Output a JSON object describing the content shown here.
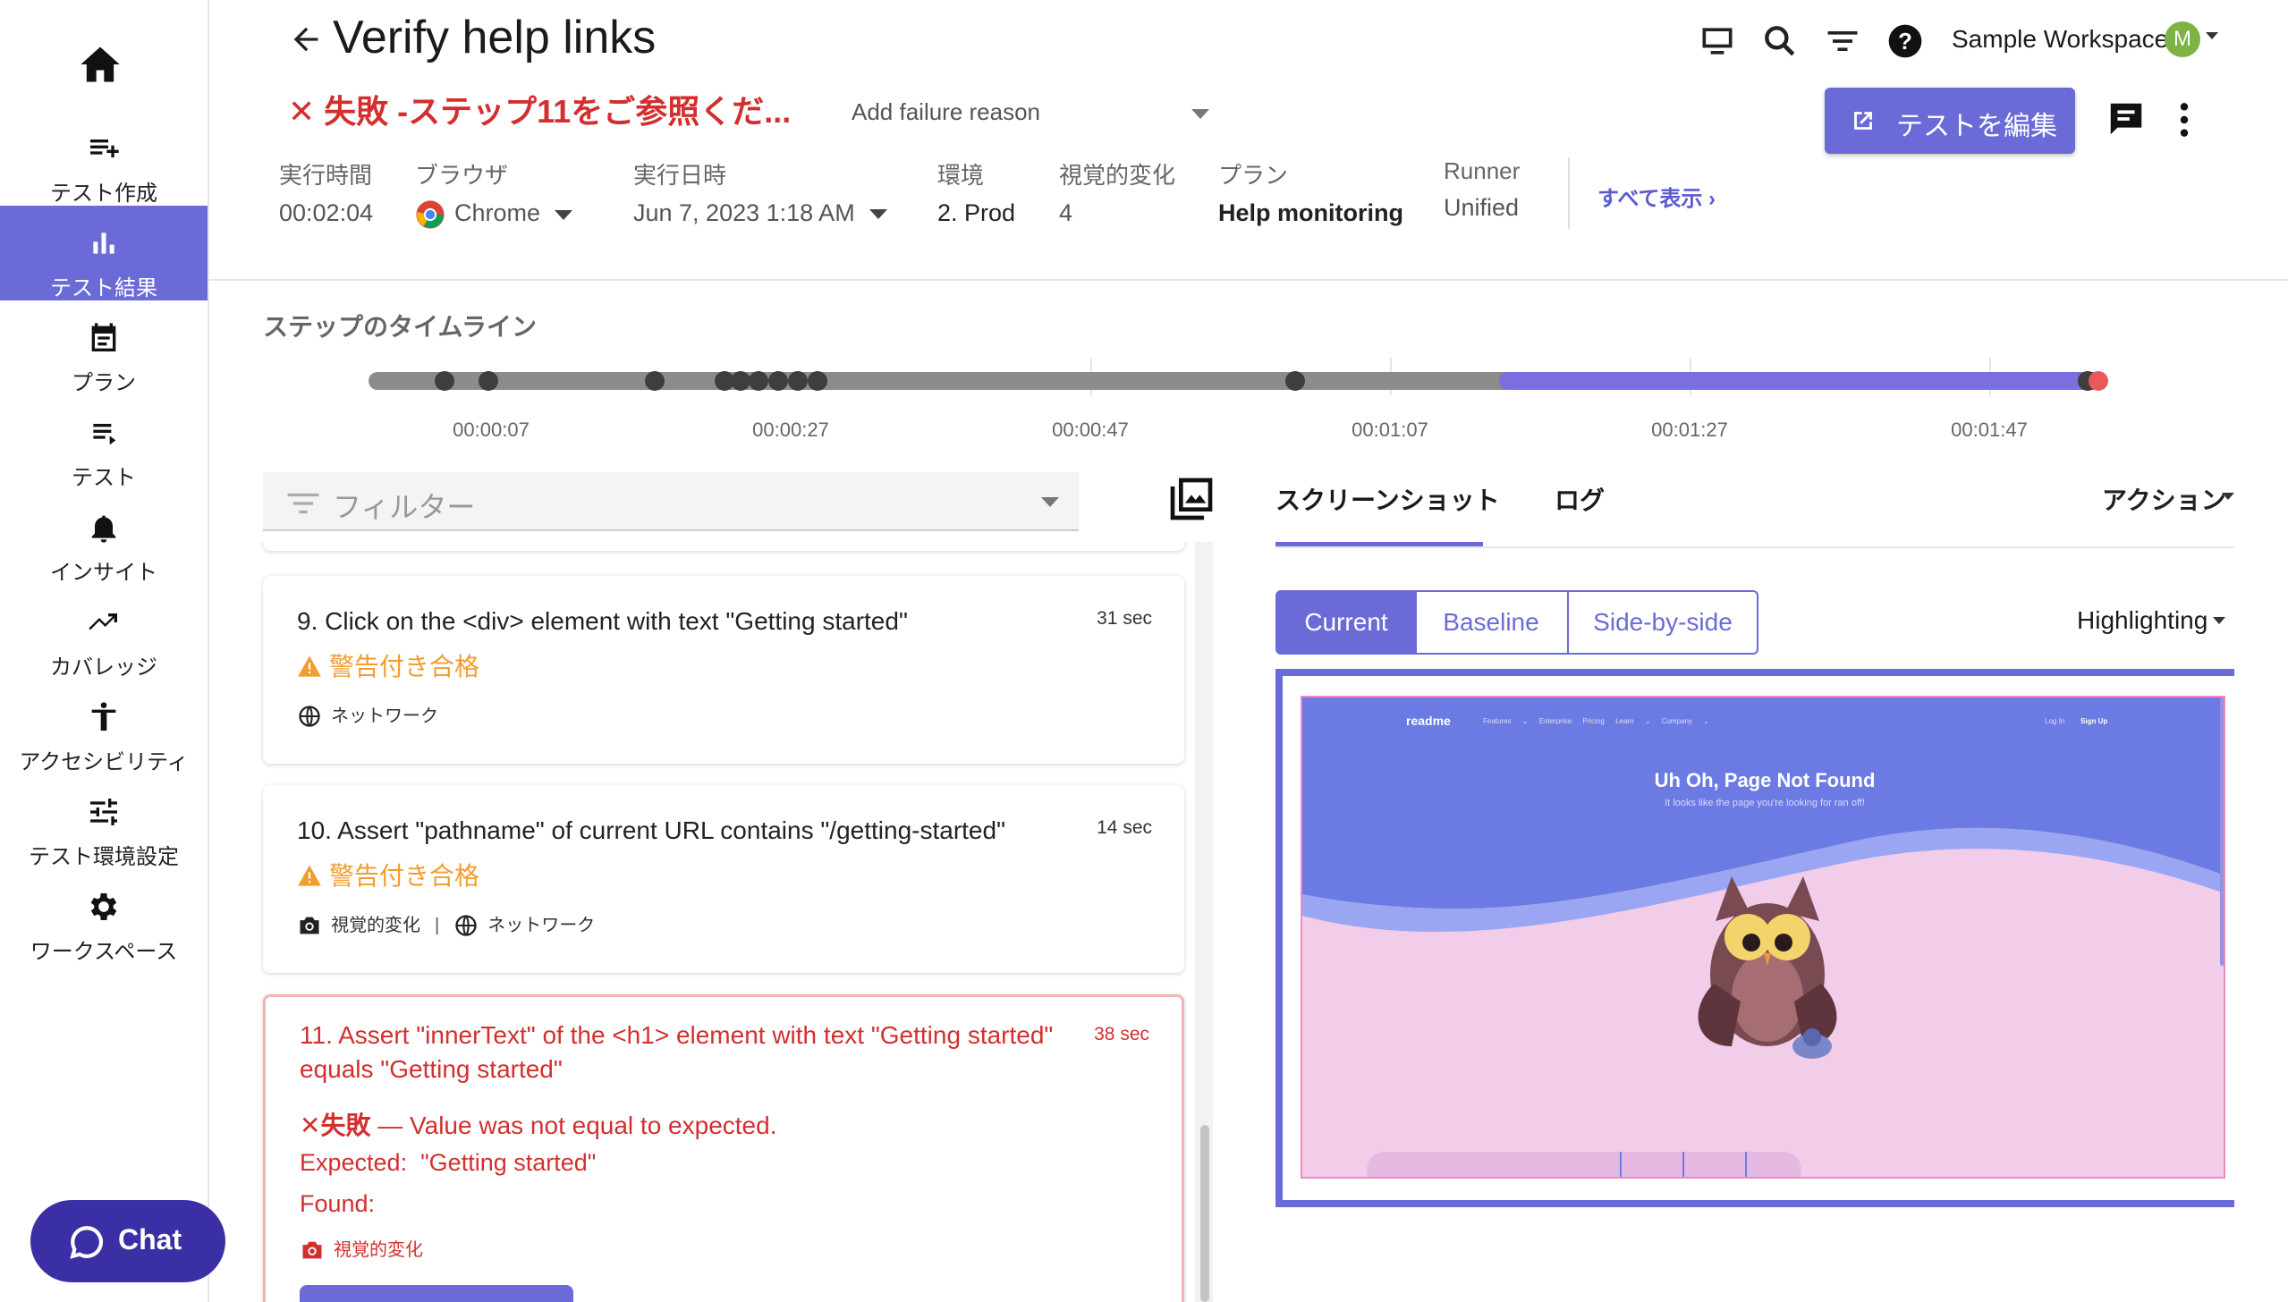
{
  "sidebar": {
    "home_label": "home",
    "items": [
      {
        "label": "テスト作成",
        "icon": "playlist-add-icon"
      },
      {
        "label": "テスト結果",
        "icon": "bar-chart-icon",
        "active": true
      },
      {
        "label": "プラン",
        "icon": "calendar-icon"
      },
      {
        "label": "テスト",
        "icon": "list-icon"
      },
      {
        "label": "インサイト",
        "icon": "bell-icon"
      },
      {
        "label": "カバレッジ",
        "icon": "trending-up-icon"
      },
      {
        "label": "アクセシビリティ",
        "icon": "accessibility-icon"
      },
      {
        "label": "テスト環境設定",
        "icon": "sliders-icon"
      },
      {
        "label": "ワークスペース",
        "icon": "gear-icon"
      }
    ],
    "chat_label": "Chat"
  },
  "header": {
    "title": "Verify help links",
    "status": "失敗 -ステップ11をご参照くだ...",
    "failure_reason_placeholder": "Add failure reason",
    "workspace": "Sample Workspace",
    "avatar_initial": "M",
    "edit_button": "テストを編集",
    "show_all": "すべて表示 ›"
  },
  "meta": {
    "duration_label": "実行時間",
    "duration": "00:02:04",
    "browser_label": "ブラウザ",
    "browser": "Chrome",
    "run_date_label": "実行日時",
    "run_date": "Jun 7, 2023 1:18 AM",
    "env_label": "環境",
    "env": "2. Prod",
    "visual_label": "視覚的変化",
    "visual": "4",
    "plan_label": "プラン",
    "plan": "Help monitoring",
    "runner_label": "Runner",
    "runner": "Unified"
  },
  "timeline": {
    "title": "ステップのタイムライン",
    "ticks": [
      "00:00:07",
      "00:00:27",
      "00:00:47",
      "00:01:07",
      "00:01:27",
      "00:01:47"
    ]
  },
  "filter": {
    "placeholder": "フィルター"
  },
  "steps": [
    {
      "title": "9. Click on the <div> element with text \"Getting started\"",
      "duration": "31 sec",
      "status": "警告付き合格",
      "tag_network": "ネットワーク"
    },
    {
      "title": "10. Assert \"pathname\" of current URL contains \"/getting-started\"",
      "duration": "14 sec",
      "status": "警告付き合格",
      "tag_visual": "視覚的変化",
      "tag_network": "ネットワーク"
    },
    {
      "title": "11. Assert \"innerText\" of the <h1> element with text \"Getting started\" equals \"Getting started\"",
      "duration": "38 sec",
      "fail_label": "失敗",
      "fail_message": " — Value was not equal to expected.",
      "expected_label": "Expected:",
      "expected_value": "\"Getting started\"",
      "found_label": "Found:",
      "tag_visual": "視覚的変化"
    }
  ],
  "right_panel": {
    "tabs": [
      "スクリーンショット",
      "ログ"
    ],
    "action_label": "アクション",
    "segments": [
      "Current",
      "Baseline",
      "Side-by-side"
    ],
    "highlighting": "Highlighting",
    "screenshot": {
      "logo": "readme",
      "nav": "Features ⌄ Enterprise Pricing Learn ⌄ Company ⌄",
      "login": "Log In",
      "signup": "Sign Up",
      "heading": "Uh Oh, Page Not Found",
      "sub": "It looks like the page you're looking for ran off!"
    }
  },
  "colors": {
    "accent": "#6b6bd8",
    "error": "#d32f2f",
    "warning": "#f39c2f",
    "chat": "#3b2fa6"
  }
}
